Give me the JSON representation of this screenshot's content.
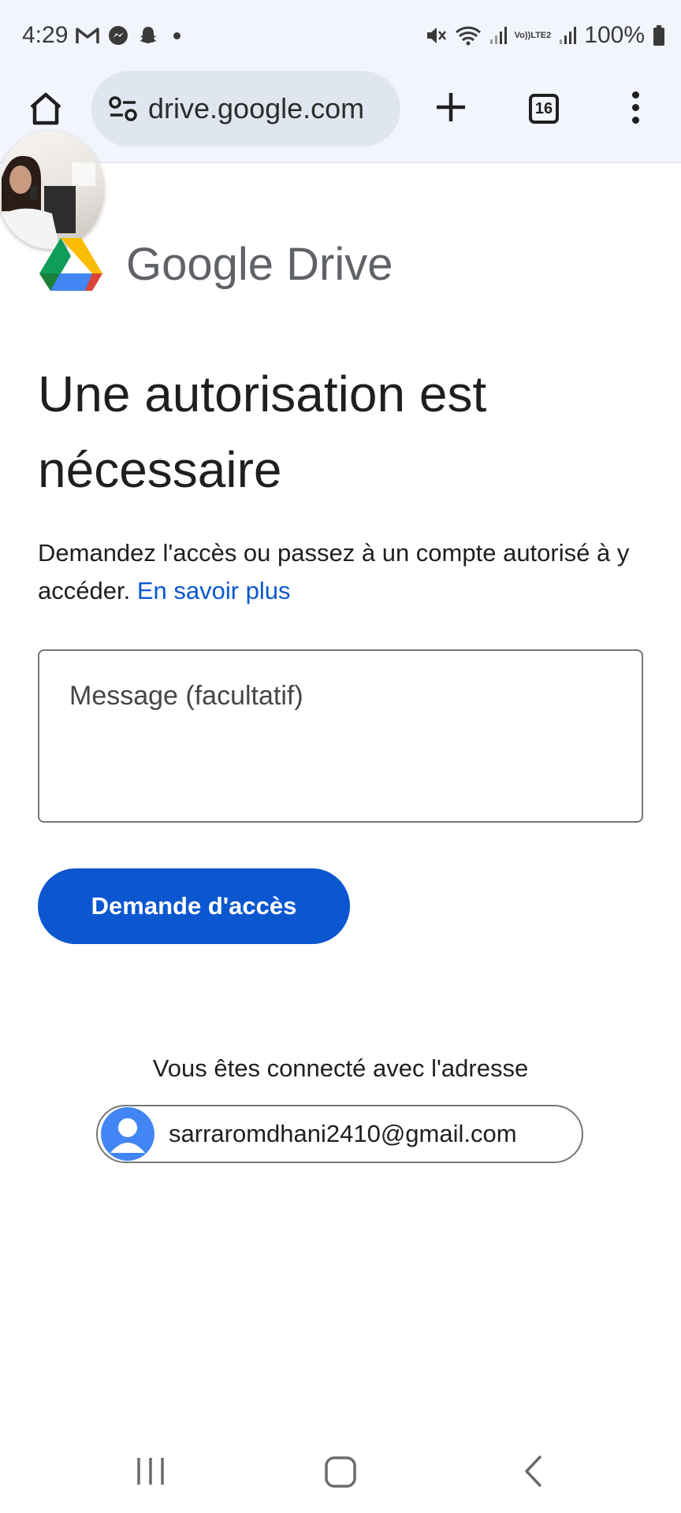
{
  "status_bar": {
    "time": "4:29",
    "battery": "100%",
    "network_label_top": "Vo))",
    "network_label_bottom": "LTE2"
  },
  "toolbar": {
    "url": "drive.google.com",
    "tab_count": "16"
  },
  "page": {
    "brand_google": "Google",
    "brand_drive": "Drive",
    "heading": "Une autorisation est nécessaire",
    "description": "Demandez l'accès ou passez à un compte autorisé à y accéder.",
    "learn_more": "En savoir plus",
    "message_placeholder": "Message (facultatif)",
    "request_button": "Demande d'accès",
    "connected_label": "Vous êtes connecté avec l'adresse",
    "account_email": "sarraromdhani2410@gmail.com"
  },
  "colors": {
    "accent": "#0b57d0",
    "drive_green": "#0f9d58",
    "drive_yellow": "#f4b400",
    "drive_blue": "#4285f4",
    "drive_red": "#db4437"
  }
}
